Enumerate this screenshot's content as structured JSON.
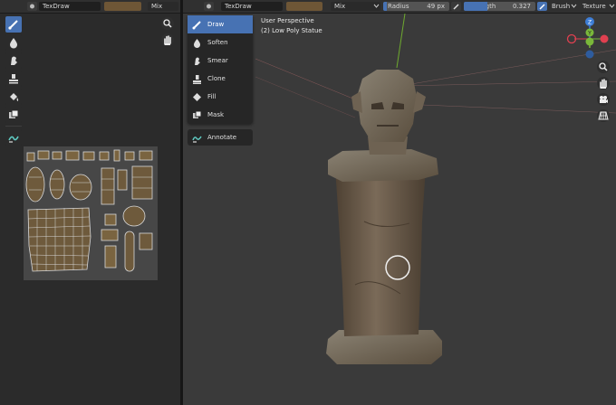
{
  "uv_header": {
    "brush_name": "TexDraw",
    "blend_mode": "Mix"
  },
  "viewport_header": {
    "brush_name": "TexDraw",
    "blend_mode": "Mix",
    "radius": {
      "label": "Radius",
      "value": "49 px"
    },
    "strength": {
      "label": "Strength",
      "value": "0.327"
    },
    "brush_menu": "Brush",
    "texture_menu": "Texture",
    "color": "#6e5636"
  },
  "tool_menu": {
    "items": [
      {
        "label": "Draw",
        "icon": "draw-brush-icon",
        "active": true
      },
      {
        "label": "Soften",
        "icon": "soften-icon",
        "active": false
      },
      {
        "label": "Smear",
        "icon": "smear-icon",
        "active": false
      },
      {
        "label": "Clone",
        "icon": "clone-stamp-icon",
        "active": false
      },
      {
        "label": "Fill",
        "icon": "fill-bucket-icon",
        "active": false
      },
      {
        "label": "Mask",
        "icon": "mask-icon",
        "active": false
      }
    ],
    "annotate": {
      "label": "Annotate",
      "icon": "annotate-icon"
    }
  },
  "viewport_info": {
    "perspective": "User Perspective",
    "object": "(2) Low Poly Statue"
  },
  "gizmo": {
    "z_label": "Z",
    "y_label": "Y",
    "x_color": "#e04050",
    "y_color": "#7ab83a",
    "z_color": "#3d7dd6"
  },
  "accent": "#4772b3"
}
